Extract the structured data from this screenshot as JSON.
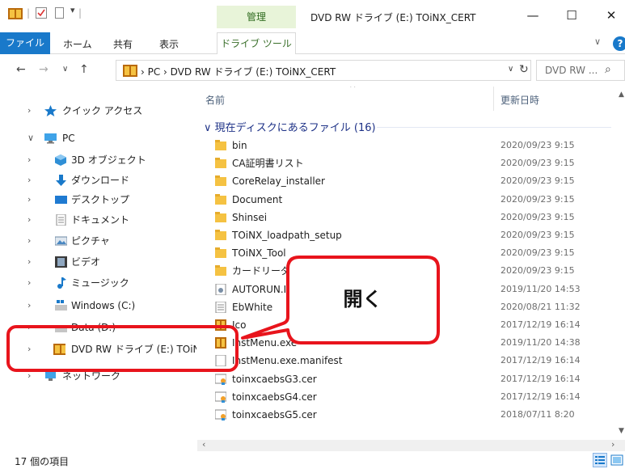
{
  "title_bar": {
    "context_tab_label": "管理",
    "window_title": "DVD RW ドライブ (E:) TOiNX_CERT",
    "minimize_glyph": "—",
    "maximize_glyph": "☐",
    "close_glyph": "✕"
  },
  "ribbon": {
    "tabs": [
      {
        "label": "ファイル"
      },
      {
        "label": "ホーム"
      },
      {
        "label": "共有"
      },
      {
        "label": "表示"
      },
      {
        "label": "ドライブ ツール"
      }
    ],
    "expand_glyph": "∨",
    "help_glyph": "?"
  },
  "address": {
    "back_glyph": "←",
    "forward_glyph": "→",
    "recent_glyph": "∨",
    "up_glyph": "↑",
    "path": "›  PC  ›  DVD RW ドライブ (E:) TOiNX_CERT",
    "dropdown_glyph": "∨",
    "refresh_glyph": "↻",
    "search_placeholder": "DVD RW ...",
    "search_glyph": "⌕"
  },
  "nav": {
    "items": [
      {
        "chevron": "›",
        "label": "クイック アクセス",
        "icon": "star-icon"
      },
      {
        "chevron": "∨",
        "label": "PC",
        "icon": "pc-icon"
      },
      {
        "chevron": "›",
        "label": "3D オブジェクト",
        "icon": "3d-objects-icon"
      },
      {
        "chevron": "›",
        "label": "ダウンロード",
        "icon": "download-icon"
      },
      {
        "chevron": "›",
        "label": "デスクトップ",
        "icon": "desktop-icon"
      },
      {
        "chevron": "›",
        "label": "ドキュメント",
        "icon": "documents-icon"
      },
      {
        "chevron": "›",
        "label": "ピクチャ",
        "icon": "pictures-icon"
      },
      {
        "chevron": "›",
        "label": "ビデオ",
        "icon": "videos-icon"
      },
      {
        "chevron": "›",
        "label": "ミュージック",
        "icon": "music-icon"
      },
      {
        "chevron": "›",
        "label": "Windows (C:)",
        "icon": "windows-drive-icon"
      },
      {
        "chevron": "›",
        "label": "Data (D:)",
        "icon": "drive-icon"
      },
      {
        "chevron": "›",
        "label": "DVD RW ドライブ (E:) TOiNX_",
        "icon": "dvd-drive-icon"
      },
      {
        "chevron": "›",
        "label": "ネットワーク",
        "icon": "network-icon"
      }
    ]
  },
  "file_list": {
    "columns": {
      "name": "名前",
      "date": "更新日時"
    },
    "sort_glyph": "^",
    "group_header": "∨ 現在ディスクにあるファイル (16)",
    "rows": [
      {
        "name": "bin",
        "date": "2020/09/23 9:15",
        "icon": "folder-icon"
      },
      {
        "name": "CA証明書リスト",
        "date": "2020/09/23 9:15",
        "icon": "folder-icon"
      },
      {
        "name": "CoreRelay_installer",
        "date": "2020/09/23 9:15",
        "icon": "folder-icon"
      },
      {
        "name": "Document",
        "date": "2020/09/23 9:15",
        "icon": "folder-icon"
      },
      {
        "name": "Shinsei",
        "date": "2020/09/23 9:15",
        "icon": "folder-icon"
      },
      {
        "name": "TOiNX_loadpath_setup",
        "date": "2020/09/23 9:15",
        "icon": "folder-icon"
      },
      {
        "name": "TOiNX_Tool",
        "date": "2020/09/23 9:15",
        "icon": "folder-icon"
      },
      {
        "name": "カードリーダー",
        "date": "2020/09/23 9:15",
        "icon": "folder-icon"
      },
      {
        "name": "AUTORUN.INF",
        "date": "2019/11/20 14:53",
        "icon": "settings-file-icon"
      },
      {
        "name": "EbWhite",
        "date": "2020/08/21 11:32",
        "icon": "text-file-icon"
      },
      {
        "name": "Ico",
        "date": "2017/12/19 16:14",
        "icon": "app-icon"
      },
      {
        "name": "InstMenu.exe",
        "date": "2019/11/20 14:38",
        "icon": "app-icon"
      },
      {
        "name": "InstMenu.exe.manifest",
        "date": "2017/12/19 16:14",
        "icon": "file-icon"
      },
      {
        "name": "toinxcaebsG3.cer",
        "date": "2017/12/19 16:14",
        "icon": "certificate-icon"
      },
      {
        "name": "toinxcaebsG4.cer",
        "date": "2017/12/19 16:14",
        "icon": "certificate-icon"
      },
      {
        "name": "toinxcaebsG5.cer",
        "date": "2018/07/11 8:20",
        "icon": "certificate-icon"
      }
    ]
  },
  "scroll": {
    "left_glyph": "‹",
    "right_glyph": "›",
    "up_glyph": "▲",
    "down_glyph": "▼"
  },
  "status": {
    "item_count": "17 個の項目"
  },
  "annotation": {
    "callout_text": "開く"
  },
  "colors": {
    "accent": "#1979ca",
    "highlight": "#e8141c",
    "context_tab": "#e8f4d9",
    "folder": "#f5c242"
  }
}
